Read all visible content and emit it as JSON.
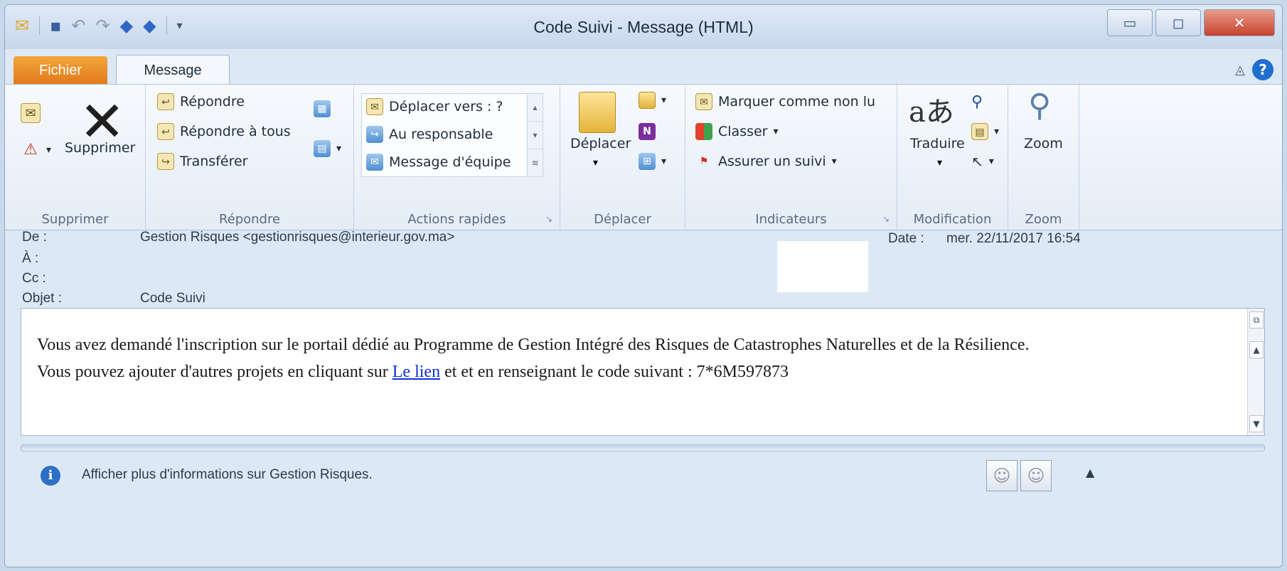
{
  "window": {
    "title": "Code Suivi  -  Message (HTML)",
    "controls": {
      "minimize": "▭",
      "maximize": "◻",
      "close": "✕"
    }
  },
  "quick_access": [
    "save-icon",
    "undo-icon",
    "redo-icon",
    "up-arrow-icon",
    "down-arrow-icon",
    "customize-icon"
  ],
  "tabs": {
    "file": "Fichier",
    "message": "Message"
  },
  "ribbon": {
    "supprimer": {
      "label": "Supprimer",
      "delete_button": "Supprimer"
    },
    "repondre": {
      "label": "Répondre",
      "reply": "Répondre",
      "reply_all": "Répondre à tous",
      "forward": "Transférer"
    },
    "actions_rapides": {
      "label": "Actions rapides",
      "items": [
        "Déplacer vers : ?",
        "Au responsable",
        "Message d'équipe"
      ]
    },
    "deplacer": {
      "label": "Déplacer",
      "move_button": "Déplacer"
    },
    "indicateurs": {
      "label": "Indicateurs",
      "mark_unread": "Marquer comme non lu",
      "categorize": "Classer",
      "follow_up": "Assurer un suivi"
    },
    "modification": {
      "label": "Modification",
      "translate": "Traduire"
    },
    "zoom": {
      "label": "Zoom",
      "zoom_button": "Zoom"
    }
  },
  "header": {
    "from_label": "De :",
    "from_value": "Gestion Risques <gestionrisques@interieur.gov.ma>",
    "to_label": "À :",
    "cc_label": "Cc :",
    "subject_label": "Objet :",
    "subject_value": "Code Suivi",
    "date_label": "Date :",
    "date_value": "mer. 22/11/2017 16:54"
  },
  "body": {
    "line1": "Vous avez demandé l'inscription sur le portail dédié au Programme de Gestion Intégré des Risques de Catastrophes Naturelles et de la Résilience.",
    "line2_pre": "Vous pouvez ajouter d'autres projets en cliquant sur ",
    "link": "Le lien",
    "line2_post": " et et en renseignant le code suivant : 7*6M597873"
  },
  "people_pane": {
    "info": "Afficher plus d'informations sur Gestion Risques."
  }
}
